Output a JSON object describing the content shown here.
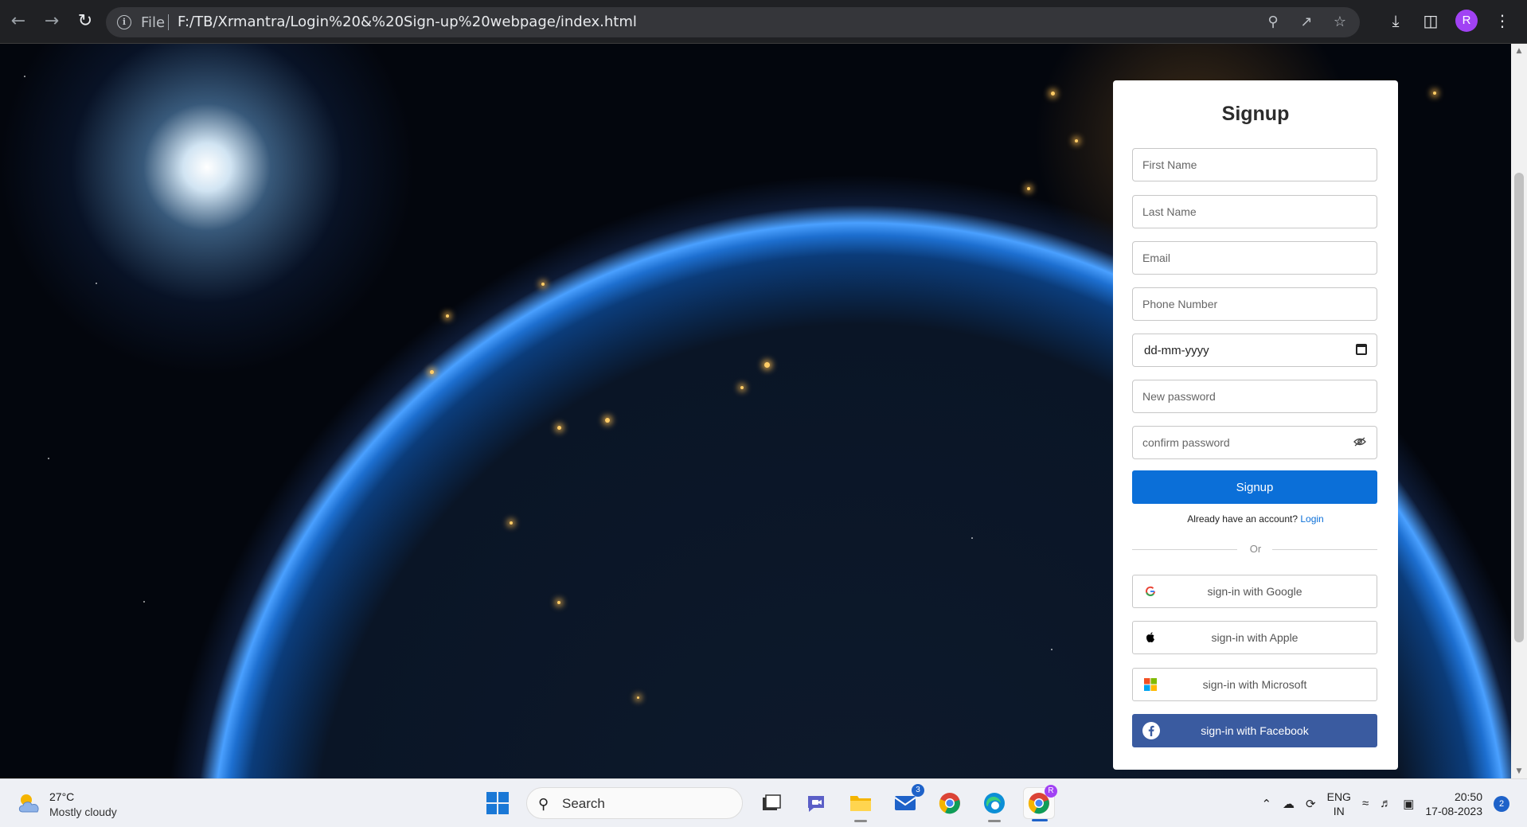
{
  "browser": {
    "file_label": "File",
    "url": "F:/TB/Xrmantra/Login%20&%20Sign-up%20webpage/index.html",
    "profile_initial": "R"
  },
  "signup": {
    "title": "Signup",
    "first_name_placeholder": "First Name",
    "last_name_placeholder": "Last Name",
    "email_placeholder": "Email",
    "phone_placeholder": "Phone Number",
    "date_value": "dd-mm-yyyy",
    "new_password_placeholder": "New password",
    "confirm_password_placeholder": "confirm password",
    "submit_label": "Signup",
    "already_text": "Already have an account?",
    "login_link": "Login",
    "or_text": "Or",
    "google_label": "sign-in with Google",
    "apple_label": "sign-in with Apple",
    "microsoft_label": "sign-in with Microsoft",
    "facebook_label": "sign-in with Facebook",
    "accent_color": "#0b6fd8",
    "facebook_color": "#3a5ba0"
  },
  "taskbar": {
    "weather_temp": "27°C",
    "weather_desc": "Mostly cloudy",
    "search_label": "Search",
    "mail_badge": "3",
    "chrome_badge": "R",
    "lang_primary": "ENG",
    "lang_secondary": "IN",
    "time": "20:50",
    "date": "17-08-2023",
    "notification_count": "2"
  }
}
